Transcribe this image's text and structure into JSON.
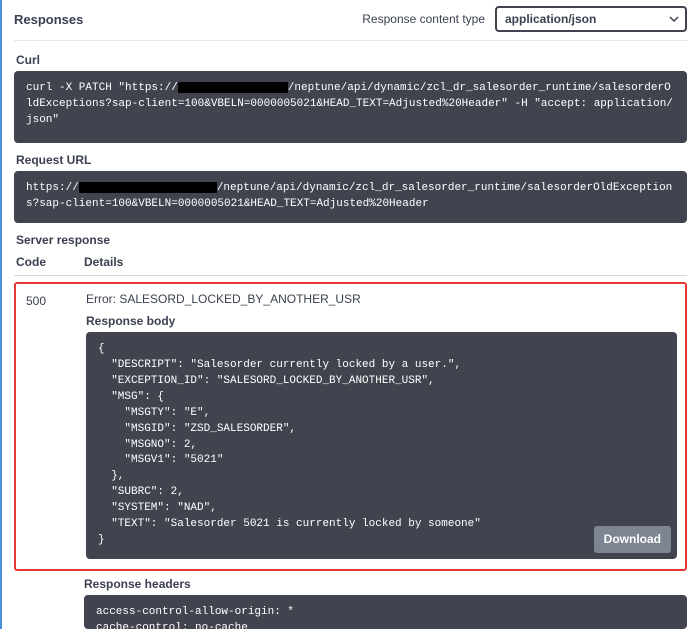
{
  "header": {
    "title": "Responses",
    "contentTypeLabel": "Response content type",
    "contentTypeValue": "application/json"
  },
  "curl": {
    "label": "Curl",
    "prefix": "curl -X PATCH \"https://",
    "rest": "/neptune/api/dynamic/zcl_dr_salesorder_runtime/salesorderOldExceptions?sap-client=100&VBELN=0000005021&HEAD_TEXT=Adjusted%20Header\" -H \"accept: application/json\""
  },
  "requestUrl": {
    "label": "Request URL",
    "prefix": "https://",
    "rest": "/neptune/api/dynamic/zcl_dr_salesorder_runtime/salesorderOldExceptions?sap-client=100&VBELN=0000005021&HEAD_TEXT=Adjusted%20Header"
  },
  "serverResponse": {
    "label": "Server response",
    "codeHeader": "Code",
    "detailsHeader": "Details"
  },
  "response": {
    "code": "500",
    "error": "Error: SALESORD_LOCKED_BY_ANOTHER_USR",
    "bodyLabel": "Response body",
    "body": "{\n  \"DESCRIPT\": \"Salesorder currently locked by a user.\",\n  \"EXCEPTION_ID\": \"SALESORD_LOCKED_BY_ANOTHER_USR\",\n  \"MSG\": {\n    \"MSGTY\": \"E\",\n    \"MSGID\": \"ZSD_SALESORDER\",\n    \"MSGNO\": 2,\n    \"MSGV1\": \"5021\"\n  },\n  \"SUBRC\": 2,\n  \"SYSTEM\": \"NAD\",\n  \"TEXT\": \"Salesorder 5021 is currently locked by someone\"\n}",
    "downloadLabel": "Download"
  },
  "responseHeaders": {
    "label": "Response headers",
    "body": "access-control-allow-origin: *\ncache-control: no-cache\nconnection: close"
  }
}
